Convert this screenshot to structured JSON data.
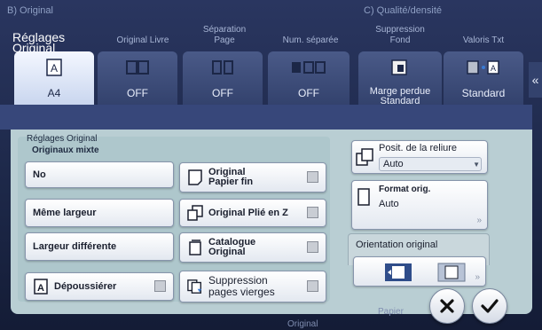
{
  "sections": {
    "b_title": "B) Original",
    "c_title": "C) Qualité/densité"
  },
  "tabs": [
    {
      "label": "Réglages Original"
    },
    {
      "label": "Original Livre"
    },
    {
      "label_1": "Séparation",
      "label_2": "Page"
    },
    {
      "label": "Num. séparée"
    },
    {
      "label_1": "Suppression",
      "label_2": "Fond"
    },
    {
      "label": "Valoris Txt"
    }
  ],
  "tiles": [
    {
      "value": "A4",
      "icon": "original-a-icon",
      "selected": true
    },
    {
      "value": "OFF",
      "icon": "open-book-icon"
    },
    {
      "value": "OFF",
      "icon": "page-separation-icon"
    },
    {
      "value": "OFF",
      "icon": "numbered-pages-icon"
    },
    {
      "value_1": "Marge perdue",
      "value_2": "Standard",
      "icon": "background-removal-icon"
    },
    {
      "value": "Standard",
      "icon": "text-enhance-icon"
    }
  ],
  "dialog": {
    "title": "Réglages Original",
    "subtitle": "Originaux mixte",
    "mixed_buttons": [
      "No",
      "Même largeur",
      "Largeur différente"
    ],
    "dust_removal": "Dépoussiérer",
    "thin_paper_1": "Original",
    "thin_paper_2": "Papier fin",
    "z_folded": "Original Plié en Z",
    "catalog_1": "Catalogue",
    "catalog_2": "Original",
    "blank_removal_1": "Suppression",
    "blank_removal_2": "pages vierges",
    "binding_label": "Posit. de la reliure",
    "binding_value": "Auto",
    "format_label": "Format orig.",
    "format_value": "Auto",
    "orientation_label": "Orientation original"
  },
  "footer": {
    "original": "Original",
    "paper": "Papier"
  },
  "colors": {
    "panel": "#b9ced3",
    "band": "#37477a",
    "selected_tile": "#f4f7ff"
  }
}
